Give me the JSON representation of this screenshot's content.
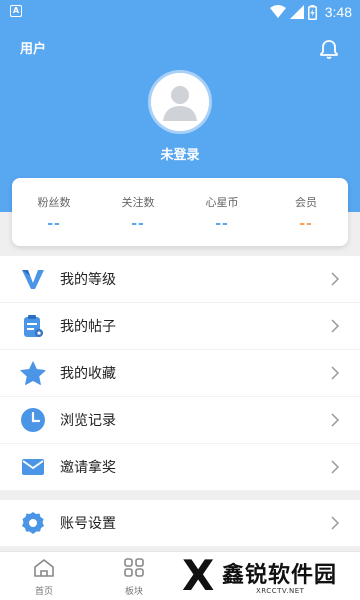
{
  "status_bar": {
    "time": "3:48",
    "app_badge": "A"
  },
  "header": {
    "title": "用户",
    "login_status": "未登录"
  },
  "stats": [
    {
      "label": "粉丝数",
      "value": "--"
    },
    {
      "label": "关注数",
      "value": "--"
    },
    {
      "label": "心星币",
      "value": "--"
    },
    {
      "label": "会员",
      "value": "--"
    }
  ],
  "menu": [
    {
      "label": "我的等级",
      "icon": "v-level-icon"
    },
    {
      "label": "我的帖子",
      "icon": "clipboard-icon"
    },
    {
      "label": "我的收藏",
      "icon": "star-icon"
    },
    {
      "label": "浏览记录",
      "icon": "clock-icon"
    },
    {
      "label": "邀请拿奖",
      "icon": "mail-icon"
    }
  ],
  "menu2": [
    {
      "label": "账号设置",
      "icon": "gear-icon"
    }
  ],
  "tabs": [
    {
      "label": "首页",
      "icon": "home-icon"
    },
    {
      "label": "板块",
      "icon": "grid-icon"
    }
  ],
  "watermark": {
    "name": "鑫锐软件园",
    "url": "XRCCTV.NET"
  },
  "colors": {
    "primary": "#58a7f1",
    "accent_orange": "#f7a15a"
  }
}
